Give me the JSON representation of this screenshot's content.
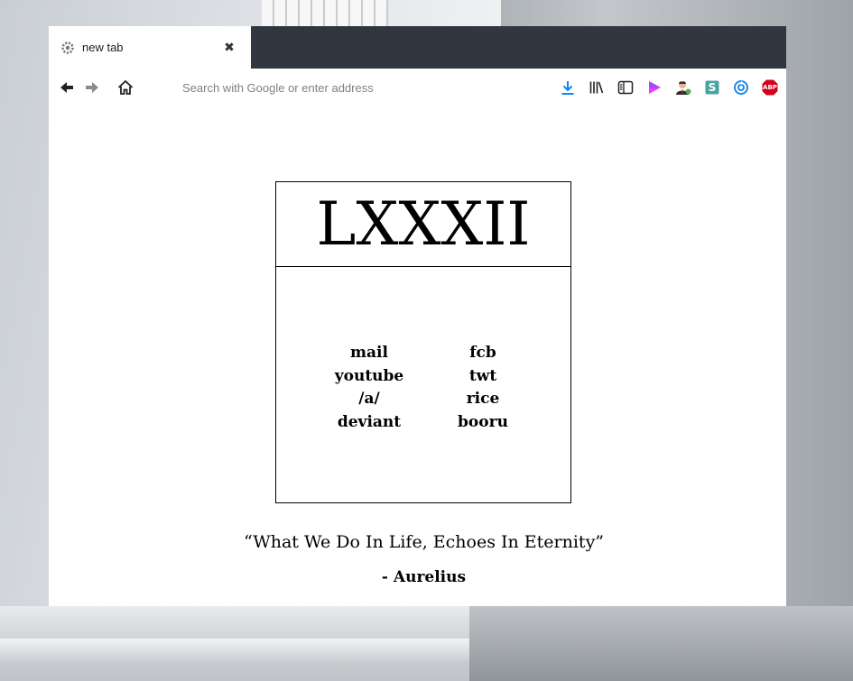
{
  "browser": {
    "tab": {
      "title": "new tab",
      "close_glyph": "✖",
      "favicon": "gear-icon"
    },
    "navbar": {
      "back_icon": "arrow-left-icon",
      "forward_icon": "arrow-right-icon",
      "home_icon": "home-icon",
      "url_placeholder": "Search with Google or enter address",
      "url_value": "",
      "toolbar_icons": [
        "download-icon",
        "library-icon",
        "sidebar-icon",
        "play-icon",
        "user-agent-icon",
        "stylus-icon",
        "sync-icon",
        "adblock-icon"
      ],
      "adblock_badge": "ABP",
      "stylus_badge": "S"
    },
    "colors": {
      "tabbar": "#323640",
      "download": "#0a84ff",
      "play": "#e040fb",
      "adblock": "#d3001b",
      "stylus": "#4aa3a3"
    }
  },
  "page": {
    "title": "LXXXII",
    "links_left": [
      "mail",
      "youtube",
      "/a/",
      "deviant"
    ],
    "links_right": [
      "fcb",
      "twt",
      "rice",
      "booru"
    ],
    "quote": "“What We Do In Life, Echoes In Eternity”",
    "author": "- Aurelius"
  }
}
